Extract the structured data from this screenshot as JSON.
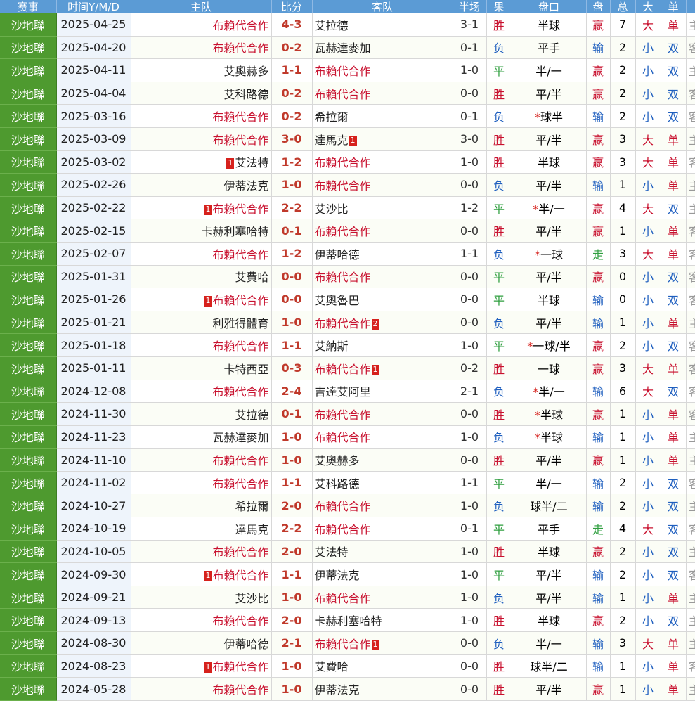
{
  "header": [
    "赛事",
    "时间Y/M/D",
    "主队",
    "比分",
    "客队",
    "半场",
    "果",
    "盘口",
    "盘",
    "总",
    "大",
    "单",
    ""
  ],
  "colors": {
    "league_bg": "#4e9a2f",
    "header_bg": "#5b9bd5",
    "win": "#c8102e",
    "loss": "#1f5fbf",
    "draw": "#2e9e3e",
    "red_card": "#d6211c"
  },
  "rows": [
    {
      "league": "沙地聯",
      "date": "2025-04-25",
      "home": "布賴代合作",
      "home_hl": true,
      "home_rc": "",
      "score": "4-3",
      "away": "艾拉德",
      "away_hl": false,
      "away_rc": "",
      "ht": "3-1",
      "res": "胜",
      "hc_star": "",
      "hc": "半球",
      "hr": "赢",
      "tot": "7",
      "ou": "大",
      "oe": "单",
      "edge": "主"
    },
    {
      "league": "沙地聯",
      "date": "2025-04-20",
      "home": "布賴代合作",
      "home_hl": true,
      "home_rc": "",
      "score": "0-2",
      "away": "瓦赫達麥加",
      "away_hl": false,
      "away_rc": "",
      "ht": "0-1",
      "res": "负",
      "hc_star": "",
      "hc": "平手",
      "hr": "输",
      "tot": "2",
      "ou": "小",
      "oe": "双",
      "edge": "客"
    },
    {
      "league": "沙地聯",
      "date": "2025-04-11",
      "home": "艾奧赫多",
      "home_hl": false,
      "home_rc": "",
      "score": "1-1",
      "away": "布賴代合作",
      "away_hl": true,
      "away_rc": "",
      "ht": "1-0",
      "res": "平",
      "hc_star": "",
      "hc": "半/一",
      "hr": "赢",
      "tot": "2",
      "ou": "小",
      "oe": "双",
      "edge": "主"
    },
    {
      "league": "沙地聯",
      "date": "2025-04-04",
      "home": "艾科路德",
      "home_hl": false,
      "home_rc": "",
      "score": "0-2",
      "away": "布賴代合作",
      "away_hl": true,
      "away_rc": "",
      "ht": "0-0",
      "res": "胜",
      "hc_star": "",
      "hc": "平/半",
      "hr": "赢",
      "tot": "2",
      "ou": "小",
      "oe": "双",
      "edge": "客"
    },
    {
      "league": "沙地聯",
      "date": "2025-03-16",
      "home": "布賴代合作",
      "home_hl": true,
      "home_rc": "",
      "score": "0-2",
      "away": "希拉爾",
      "away_hl": false,
      "away_rc": "",
      "ht": "0-1",
      "res": "负",
      "hc_star": "*",
      "hc": "球半",
      "hr": "输",
      "tot": "2",
      "ou": "小",
      "oe": "双",
      "edge": "客"
    },
    {
      "league": "沙地聯",
      "date": "2025-03-09",
      "home": "布賴代合作",
      "home_hl": true,
      "home_rc": "",
      "score": "3-0",
      "away": "達馬克",
      "away_hl": false,
      "away_rc": "1",
      "ht": "3-0",
      "res": "胜",
      "hc_star": "",
      "hc": "平/半",
      "hr": "赢",
      "tot": "3",
      "ou": "大",
      "oe": "单",
      "edge": "主"
    },
    {
      "league": "沙地聯",
      "date": "2025-03-02",
      "home": "艾法特",
      "home_hl": false,
      "home_rc": "1",
      "score": "1-2",
      "away": "布賴代合作",
      "away_hl": true,
      "away_rc": "",
      "ht": "1-0",
      "res": "胜",
      "hc_star": "",
      "hc": "半球",
      "hr": "赢",
      "tot": "3",
      "ou": "大",
      "oe": "单",
      "edge": "客"
    },
    {
      "league": "沙地聯",
      "date": "2025-02-26",
      "home": "伊蒂法克",
      "home_hl": false,
      "home_rc": "",
      "score": "1-0",
      "away": "布賴代合作",
      "away_hl": true,
      "away_rc": "",
      "ht": "0-0",
      "res": "负",
      "hc_star": "",
      "hc": "平/半",
      "hr": "输",
      "tot": "1",
      "ou": "小",
      "oe": "单",
      "edge": "主"
    },
    {
      "league": "沙地聯",
      "date": "2025-02-22",
      "home": "布賴代合作",
      "home_hl": true,
      "home_rc": "1",
      "score": "2-2",
      "away": "艾沙比",
      "away_hl": false,
      "away_rc": "",
      "ht": "1-2",
      "res": "平",
      "hc_star": "*",
      "hc": "半/一",
      "hr": "赢",
      "tot": "4",
      "ou": "大",
      "oe": "双",
      "edge": "主"
    },
    {
      "league": "沙地聯",
      "date": "2025-02-15",
      "home": "卡赫利塞哈特",
      "home_hl": false,
      "home_rc": "",
      "score": "0-1",
      "away": "布賴代合作",
      "away_hl": true,
      "away_rc": "",
      "ht": "0-0",
      "res": "胜",
      "hc_star": "",
      "hc": "平/半",
      "hr": "赢",
      "tot": "1",
      "ou": "小",
      "oe": "单",
      "edge": "客"
    },
    {
      "league": "沙地聯",
      "date": "2025-02-07",
      "home": "布賴代合作",
      "home_hl": true,
      "home_rc": "",
      "score": "1-2",
      "away": "伊蒂哈德",
      "away_hl": false,
      "away_rc": "",
      "ht": "1-1",
      "res": "负",
      "hc_star": "*",
      "hc": "一球",
      "hr": "走",
      "tot": "3",
      "ou": "大",
      "oe": "单",
      "edge": "客"
    },
    {
      "league": "沙地聯",
      "date": "2025-01-31",
      "home": "艾費哈",
      "home_hl": false,
      "home_rc": "",
      "score": "0-0",
      "away": "布賴代合作",
      "away_hl": true,
      "away_rc": "",
      "ht": "0-0",
      "res": "平",
      "hc_star": "",
      "hc": "平/半",
      "hr": "赢",
      "tot": "0",
      "ou": "小",
      "oe": "双",
      "edge": "客"
    },
    {
      "league": "沙地聯",
      "date": "2025-01-26",
      "home": "布賴代合作",
      "home_hl": true,
      "home_rc": "1",
      "score": "0-0",
      "away": "艾奧魯巴",
      "away_hl": false,
      "away_rc": "",
      "ht": "0-0",
      "res": "平",
      "hc_star": "",
      "hc": "半球",
      "hr": "输",
      "tot": "0",
      "ou": "小",
      "oe": "双",
      "edge": "客"
    },
    {
      "league": "沙地聯",
      "date": "2025-01-21",
      "home": "利雅得體育",
      "home_hl": false,
      "home_rc": "",
      "score": "1-0",
      "away": "布賴代合作",
      "away_hl": true,
      "away_rc": "2",
      "ht": "0-0",
      "res": "负",
      "hc_star": "",
      "hc": "平/半",
      "hr": "输",
      "tot": "1",
      "ou": "小",
      "oe": "单",
      "edge": "主"
    },
    {
      "league": "沙地聯",
      "date": "2025-01-18",
      "home": "布賴代合作",
      "home_hl": true,
      "home_rc": "",
      "score": "1-1",
      "away": "艾納斯",
      "away_hl": false,
      "away_rc": "",
      "ht": "1-0",
      "res": "平",
      "hc_star": "*",
      "hc": "一球/半",
      "hr": "赢",
      "tot": "2",
      "ou": "小",
      "oe": "双",
      "edge": "客"
    },
    {
      "league": "沙地聯",
      "date": "2025-01-11",
      "home": "卡特西亞",
      "home_hl": false,
      "home_rc": "",
      "score": "0-3",
      "away": "布賴代合作",
      "away_hl": true,
      "away_rc": "1",
      "ht": "0-2",
      "res": "胜",
      "hc_star": "",
      "hc": "一球",
      "hr": "赢",
      "tot": "3",
      "ou": "大",
      "oe": "单",
      "edge": "客"
    },
    {
      "league": "沙地聯",
      "date": "2024-12-08",
      "home": "布賴代合作",
      "home_hl": true,
      "home_rc": "",
      "score": "2-4",
      "away": "吉達艾阿里",
      "away_hl": false,
      "away_rc": "",
      "ht": "2-1",
      "res": "负",
      "hc_star": "*",
      "hc": "半/一",
      "hr": "输",
      "tot": "6",
      "ou": "大",
      "oe": "双",
      "edge": "客"
    },
    {
      "league": "沙地聯",
      "date": "2024-11-30",
      "home": "艾拉德",
      "home_hl": false,
      "home_rc": "",
      "score": "0-1",
      "away": "布賴代合作",
      "away_hl": true,
      "away_rc": "",
      "ht": "0-0",
      "res": "胜",
      "hc_star": "*",
      "hc": "半球",
      "hr": "赢",
      "tot": "1",
      "ou": "小",
      "oe": "单",
      "edge": "客"
    },
    {
      "league": "沙地聯",
      "date": "2024-11-23",
      "home": "瓦赫達麥加",
      "home_hl": false,
      "home_rc": "",
      "score": "1-0",
      "away": "布賴代合作",
      "away_hl": true,
      "away_rc": "",
      "ht": "1-0",
      "res": "负",
      "hc_star": "*",
      "hc": "半球",
      "hr": "输",
      "tot": "1",
      "ou": "小",
      "oe": "单",
      "edge": "主"
    },
    {
      "league": "沙地聯",
      "date": "2024-11-10",
      "home": "布賴代合作",
      "home_hl": true,
      "home_rc": "",
      "score": "1-0",
      "away": "艾奧赫多",
      "away_hl": false,
      "away_rc": "",
      "ht": "0-0",
      "res": "胜",
      "hc_star": "",
      "hc": "平/半",
      "hr": "赢",
      "tot": "1",
      "ou": "小",
      "oe": "单",
      "edge": "主"
    },
    {
      "league": "沙地聯",
      "date": "2024-11-02",
      "home": "布賴代合作",
      "home_hl": true,
      "home_rc": "",
      "score": "1-1",
      "away": "艾科路德",
      "away_hl": false,
      "away_rc": "",
      "ht": "1-1",
      "res": "平",
      "hc_star": "",
      "hc": "半/一",
      "hr": "输",
      "tot": "2",
      "ou": "小",
      "oe": "双",
      "edge": "客"
    },
    {
      "league": "沙地聯",
      "date": "2024-10-27",
      "home": "希拉爾",
      "home_hl": false,
      "home_rc": "",
      "score": "2-0",
      "away": "布賴代合作",
      "away_hl": true,
      "away_rc": "",
      "ht": "1-0",
      "res": "负",
      "hc_star": "",
      "hc": "球半/二",
      "hr": "输",
      "tot": "2",
      "ou": "小",
      "oe": "双",
      "edge": "主"
    },
    {
      "league": "沙地聯",
      "date": "2024-10-19",
      "home": "達馬克",
      "home_hl": false,
      "home_rc": "",
      "score": "2-2",
      "away": "布賴代合作",
      "away_hl": true,
      "away_rc": "",
      "ht": "0-1",
      "res": "平",
      "hc_star": "",
      "hc": "平手",
      "hr": "走",
      "tot": "4",
      "ou": "大",
      "oe": "双",
      "edge": "客"
    },
    {
      "league": "沙地聯",
      "date": "2024-10-05",
      "home": "布賴代合作",
      "home_hl": true,
      "home_rc": "",
      "score": "2-0",
      "away": "艾法特",
      "away_hl": false,
      "away_rc": "",
      "ht": "1-0",
      "res": "胜",
      "hc_star": "",
      "hc": "半球",
      "hr": "赢",
      "tot": "2",
      "ou": "小",
      "oe": "双",
      "edge": "主"
    },
    {
      "league": "沙地聯",
      "date": "2024-09-30",
      "home": "布賴代合作",
      "home_hl": true,
      "home_rc": "1",
      "score": "1-1",
      "away": "伊蒂法克",
      "away_hl": false,
      "away_rc": "",
      "ht": "1-0",
      "res": "平",
      "hc_star": "",
      "hc": "平/半",
      "hr": "输",
      "tot": "2",
      "ou": "小",
      "oe": "双",
      "edge": "客"
    },
    {
      "league": "沙地聯",
      "date": "2024-09-21",
      "home": "艾沙比",
      "home_hl": false,
      "home_rc": "",
      "score": "1-0",
      "away": "布賴代合作",
      "away_hl": true,
      "away_rc": "",
      "ht": "1-0",
      "res": "负",
      "hc_star": "",
      "hc": "平/半",
      "hr": "输",
      "tot": "1",
      "ou": "小",
      "oe": "单",
      "edge": "主"
    },
    {
      "league": "沙地聯",
      "date": "2024-09-13",
      "home": "布賴代合作",
      "home_hl": true,
      "home_rc": "",
      "score": "2-0",
      "away": "卡赫利塞哈特",
      "away_hl": false,
      "away_rc": "",
      "ht": "1-0",
      "res": "胜",
      "hc_star": "",
      "hc": "半球",
      "hr": "赢",
      "tot": "2",
      "ou": "小",
      "oe": "双",
      "edge": "主"
    },
    {
      "league": "沙地聯",
      "date": "2024-08-30",
      "home": "伊蒂哈德",
      "home_hl": false,
      "home_rc": "",
      "score": "2-1",
      "away": "布賴代合作",
      "away_hl": true,
      "away_rc": "1",
      "ht": "0-0",
      "res": "负",
      "hc_star": "",
      "hc": "半/一",
      "hr": "输",
      "tot": "3",
      "ou": "大",
      "oe": "单",
      "edge": "主"
    },
    {
      "league": "沙地聯",
      "date": "2024-08-23",
      "home": "布賴代合作",
      "home_hl": true,
      "home_rc": "1",
      "score": "1-0",
      "away": "艾費哈",
      "away_hl": false,
      "away_rc": "",
      "ht": "0-0",
      "res": "胜",
      "hc_star": "",
      "hc": "球半/二",
      "hr": "输",
      "tot": "1",
      "ou": "小",
      "oe": "单",
      "edge": "客"
    },
    {
      "league": "沙地聯",
      "date": "2024-05-28",
      "home": "布賴代合作",
      "home_hl": true,
      "home_rc": "",
      "score": "1-0",
      "away": "伊蒂法克",
      "away_hl": false,
      "away_rc": "",
      "ht": "0-0",
      "res": "胜",
      "hc_star": "",
      "hc": "平/半",
      "hr": "赢",
      "tot": "1",
      "ou": "小",
      "oe": "单",
      "edge": "主"
    }
  ]
}
